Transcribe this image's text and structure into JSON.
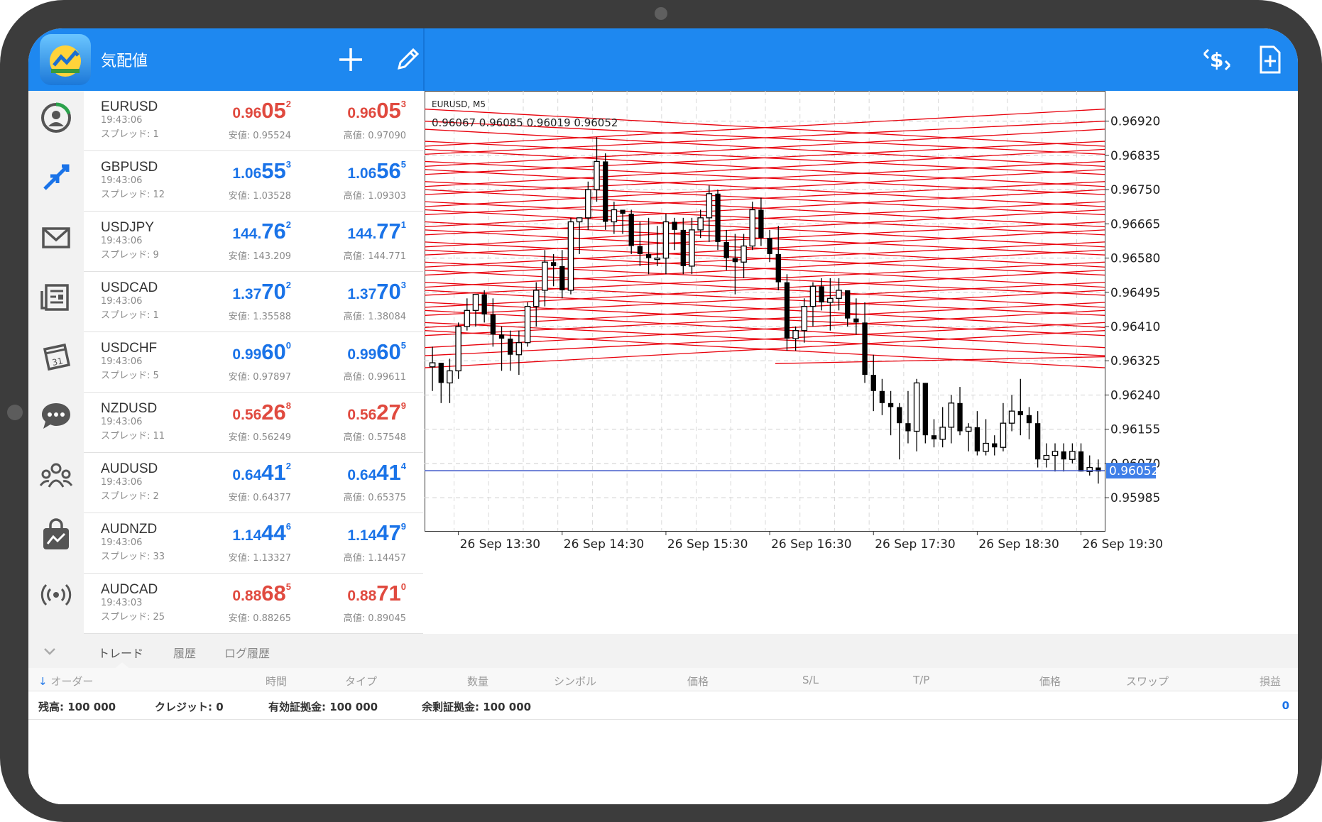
{
  "topbar": {
    "title": "気配値"
  },
  "quotes": [
    {
      "symbol": "EURUSD",
      "time": "19:43:06",
      "spread": "スプレッド: 1",
      "bid": {
        "pre": "0.96",
        "big": "05",
        "sup": "2"
      },
      "ask": {
        "pre": "0.96",
        "big": "05",
        "sup": "3"
      },
      "low": "安値: 0.95524",
      "high": "高値: 0.97090",
      "dir": "down"
    },
    {
      "symbol": "GBPUSD",
      "time": "19:43:06",
      "spread": "スプレッド: 12",
      "bid": {
        "pre": "1.06",
        "big": "55",
        "sup": "3"
      },
      "ask": {
        "pre": "1.06",
        "big": "56",
        "sup": "5"
      },
      "low": "安値: 1.03528",
      "high": "高値: 1.09303",
      "dir": "up"
    },
    {
      "symbol": "USDJPY",
      "time": "19:43:06",
      "spread": "スプレッド: 9",
      "bid": {
        "pre": "144.",
        "big": "76",
        "sup": "2"
      },
      "ask": {
        "pre": "144.",
        "big": "77",
        "sup": "1"
      },
      "low": "安値: 143.209",
      "high": "高値: 144.771",
      "dir": "up"
    },
    {
      "symbol": "USDCAD",
      "time": "19:43:06",
      "spread": "スプレッド: 1",
      "bid": {
        "pre": "1.37",
        "big": "70",
        "sup": "2"
      },
      "ask": {
        "pre": "1.37",
        "big": "70",
        "sup": "3"
      },
      "low": "安値: 1.35588",
      "high": "高値: 1.38084",
      "dir": "up"
    },
    {
      "symbol": "USDCHF",
      "time": "19:43:06",
      "spread": "スプレッド: 5",
      "bid": {
        "pre": "0.99",
        "big": "60",
        "sup": "0"
      },
      "ask": {
        "pre": "0.99",
        "big": "60",
        "sup": "5"
      },
      "low": "安値: 0.97897",
      "high": "高値: 0.99611",
      "dir": "up"
    },
    {
      "symbol": "NZDUSD",
      "time": "19:43:06",
      "spread": "スプレッド: 11",
      "bid": {
        "pre": "0.56",
        "big": "26",
        "sup": "8"
      },
      "ask": {
        "pre": "0.56",
        "big": "27",
        "sup": "9"
      },
      "low": "安値: 0.56249",
      "high": "高値: 0.57548",
      "dir": "down"
    },
    {
      "symbol": "AUDUSD",
      "time": "19:43:06",
      "spread": "スプレッド: 2",
      "bid": {
        "pre": "0.64",
        "big": "41",
        "sup": "2"
      },
      "ask": {
        "pre": "0.64",
        "big": "41",
        "sup": "4"
      },
      "low": "安値: 0.64377",
      "high": "高値: 0.65375",
      "dir": "up"
    },
    {
      "symbol": "AUDNZD",
      "time": "19:43:06",
      "spread": "スプレッド: 33",
      "bid": {
        "pre": "1.14",
        "big": "44",
        "sup": "6"
      },
      "ask": {
        "pre": "1.14",
        "big": "47",
        "sup": "9"
      },
      "low": "安値: 1.13327",
      "high": "高値: 1.14457",
      "dir": "up"
    },
    {
      "symbol": "AUDCAD",
      "time": "19:43:03",
      "spread": "スプレッド: 25",
      "bid": {
        "pre": "0.88",
        "big": "68",
        "sup": "5"
      },
      "ask": {
        "pre": "0.88",
        "big": "71",
        "sup": "0"
      },
      "low": "安値: 0.88265",
      "high": "高値: 0.89045",
      "dir": "down"
    }
  ],
  "chart": {
    "symbol_tf": "EURUSD, M5",
    "ohlc": "0.96067 0.96085 0.96019 0.96052",
    "price_labels": [
      "0.96920",
      "0.96835",
      "0.96750",
      "0.96665",
      "0.96580",
      "0.96495",
      "0.96410",
      "0.96325",
      "0.96240",
      "0.96155",
      "0.96070",
      "0.95985"
    ],
    "current_price": "0.96052",
    "time_labels": [
      "26 Sep 13:30",
      "26 Sep 14:30",
      "26 Sep 15:30",
      "26 Sep 16:30",
      "26 Sep 17:30",
      "26 Sep 18:30",
      "26 Sep 19:30"
    ],
    "colors": {
      "candle": "#000000",
      "lines": "#e8000b",
      "bid_line": "#3a55c8",
      "price_tag": "#3f7fe8"
    }
  },
  "chart_data": {
    "type": "candlestick",
    "title": "EURUSD, M5",
    "ylim": [
      0.9592,
      0.9696
    ],
    "y_ticks": [
      0.9692,
      0.96835,
      0.9675,
      0.96665,
      0.9658,
      0.96495,
      0.9641,
      0.96325,
      0.9624,
      0.96155,
      0.9607,
      0.95985
    ],
    "x_ticks": [
      "26 Sep 13:30",
      "26 Sep 14:30",
      "26 Sep 15:30",
      "26 Sep 16:30",
      "26 Sep 17:30",
      "26 Sep 18:30",
      "26 Sep 19:30"
    ],
    "current_price": 0.96052,
    "candles": [
      [
        0.9631,
        0.9636,
        0.9625,
        0.9632
      ],
      [
        0.9632,
        0.9632,
        0.9622,
        0.9627
      ],
      [
        0.9627,
        0.9633,
        0.9622,
        0.963
      ],
      [
        0.963,
        0.9642,
        0.9628,
        0.9641
      ],
      [
        0.9641,
        0.9648,
        0.964,
        0.9645
      ],
      [
        0.9645,
        0.9649,
        0.9641,
        0.9649
      ],
      [
        0.9649,
        0.965,
        0.9642,
        0.9644
      ],
      [
        0.9644,
        0.9648,
        0.9636,
        0.9639
      ],
      [
        0.9639,
        0.9641,
        0.963,
        0.9638
      ],
      [
        0.9638,
        0.964,
        0.963,
        0.9634
      ],
      [
        0.9634,
        0.964,
        0.9629,
        0.9637
      ],
      [
        0.9637,
        0.9647,
        0.9636,
        0.9646
      ],
      [
        0.9646,
        0.9652,
        0.9641,
        0.965
      ],
      [
        0.965,
        0.966,
        0.9646,
        0.9657
      ],
      [
        0.9657,
        0.9659,
        0.9651,
        0.9656
      ],
      [
        0.9656,
        0.966,
        0.9648,
        0.965
      ],
      [
        0.965,
        0.9668,
        0.9649,
        0.9667
      ],
      [
        0.9667,
        0.9668,
        0.9659,
        0.9668
      ],
      [
        0.9668,
        0.9677,
        0.9665,
        0.9675
      ],
      [
        0.9675,
        0.9688,
        0.9672,
        0.9682
      ],
      [
        0.9682,
        0.9684,
        0.9665,
        0.9667
      ],
      [
        0.9667,
        0.9672,
        0.9664,
        0.967
      ],
      [
        0.967,
        0.967,
        0.9664,
        0.9669
      ],
      [
        0.9669,
        0.967,
        0.9659,
        0.9661
      ],
      [
        0.9661,
        0.9667,
        0.9656,
        0.9659
      ],
      [
        0.9659,
        0.9668,
        0.9654,
        0.9658
      ],
      [
        0.9658,
        0.9666,
        0.9656,
        0.9658
      ],
      [
        0.9658,
        0.9669,
        0.9654,
        0.9667
      ],
      [
        0.9667,
        0.9668,
        0.966,
        0.9665
      ],
      [
        0.9665,
        0.9668,
        0.9654,
        0.9656
      ],
      [
        0.9656,
        0.9668,
        0.9654,
        0.9665
      ],
      [
        0.9665,
        0.967,
        0.9663,
        0.9668
      ],
      [
        0.9668,
        0.9676,
        0.9662,
        0.9674
      ],
      [
        0.9674,
        0.9675,
        0.966,
        0.9662
      ],
      [
        0.9662,
        0.9665,
        0.9655,
        0.9658
      ],
      [
        0.9658,
        0.9664,
        0.9649,
        0.9657
      ],
      [
        0.9657,
        0.9664,
        0.9653,
        0.9661
      ],
      [
        0.9661,
        0.9672,
        0.966,
        0.967
      ],
      [
        0.967,
        0.9673,
        0.9661,
        0.9663
      ],
      [
        0.9663,
        0.9665,
        0.9657,
        0.9659
      ],
      [
        0.9659,
        0.9666,
        0.965,
        0.9652
      ],
      [
        0.9652,
        0.9654,
        0.9635,
        0.9638
      ],
      [
        0.9638,
        0.9641,
        0.9635,
        0.964
      ],
      [
        0.964,
        0.9648,
        0.9637,
        0.9646
      ],
      [
        0.9646,
        0.9652,
        0.9641,
        0.9651
      ],
      [
        0.9651,
        0.9653,
        0.9645,
        0.9647
      ],
      [
        0.9647,
        0.9653,
        0.964,
        0.9648
      ],
      [
        0.9648,
        0.9653,
        0.9645,
        0.965
      ],
      [
        0.965,
        0.965,
        0.9641,
        0.9643
      ],
      [
        0.9643,
        0.9648,
        0.9639,
        0.9642
      ],
      [
        0.9642,
        0.9647,
        0.9627,
        0.9629
      ],
      [
        0.9629,
        0.9634,
        0.962,
        0.9625
      ],
      [
        0.9625,
        0.9628,
        0.9619,
        0.9622
      ],
      [
        0.9622,
        0.9625,
        0.9614,
        0.9621
      ],
      [
        0.9621,
        0.9622,
        0.9608,
        0.9617
      ],
      [
        0.9617,
        0.9625,
        0.9612,
        0.9615
      ],
      [
        0.9615,
        0.9628,
        0.961,
        0.9627
      ],
      [
        0.9627,
        0.9627,
        0.9612,
        0.9614
      ],
      [
        0.9614,
        0.9618,
        0.9611,
        0.9613
      ],
      [
        0.9613,
        0.9621,
        0.9611,
        0.9616
      ],
      [
        0.9616,
        0.9624,
        0.9612,
        0.9622
      ],
      [
        0.9622,
        0.9626,
        0.9614,
        0.9615
      ],
      [
        0.9615,
        0.9617,
        0.961,
        0.9616
      ],
      [
        0.9616,
        0.962,
        0.9609,
        0.961
      ],
      [
        0.961,
        0.9618,
        0.9609,
        0.9612
      ],
      [
        0.9612,
        0.9614,
        0.9609,
        0.9611
      ],
      [
        0.9611,
        0.9622,
        0.961,
        0.9617
      ],
      [
        0.9617,
        0.9624,
        0.9615,
        0.962
      ],
      [
        0.962,
        0.9628,
        0.9614,
        0.9619
      ],
      [
        0.9619,
        0.9621,
        0.9613,
        0.9617
      ],
      [
        0.9617,
        0.962,
        0.9606,
        0.9608
      ],
      [
        0.9608,
        0.9612,
        0.9606,
        0.9609
      ],
      [
        0.9609,
        0.9612,
        0.9605,
        0.961
      ],
      [
        0.961,
        0.9612,
        0.9605,
        0.9608
      ],
      [
        0.9608,
        0.9612,
        0.9607,
        0.961
      ],
      [
        0.961,
        0.9612,
        0.9605,
        0.9605
      ],
      [
        0.9605,
        0.9609,
        0.9604,
        0.9606
      ],
      [
        0.9606,
        0.9608,
        0.9602,
        0.9605
      ]
    ]
  },
  "tabs": [
    "トレード",
    "履歴",
    "ログ履歴"
  ],
  "columns": [
    "オーダー",
    "時間",
    "タイプ",
    "数量",
    "シンボル",
    "価格",
    "S/L",
    "T/P",
    "価格",
    "スワップ",
    "損益"
  ],
  "summary": {
    "balance": "残高:  100 000",
    "credit": "クレジット:  0",
    "equity": "有効証拠金:  100 000",
    "free_margin": "余剰証拠金:  100 000",
    "profit": "0"
  }
}
